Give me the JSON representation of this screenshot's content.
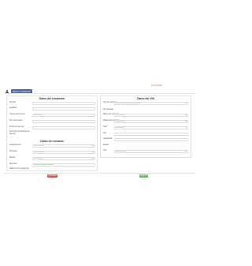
{
  "top_link": "Ir a la lista",
  "header": {
    "title": "Nuevo conductor"
  },
  "driver": {
    "title": "Datos del conductor",
    "fields": [
      {
        "label": "Nombre",
        "value": ""
      },
      {
        "label": "Apellidos",
        "value": ""
      },
      {
        "label": "Tipo de documento",
        "value": "Seleccione"
      },
      {
        "label": "Nro. documento",
        "value": ""
      },
      {
        "label": "Fecha de licencia",
        "value": ""
      },
      {
        "label": "Fecha de vencimiento de licencia",
        "value": ""
      }
    ]
  },
  "contact": {
    "title": "Datos de contacto",
    "fields": [
      {
        "label": "Departamento",
        "value": "Elija la opción"
      },
      {
        "label": "Provincia",
        "value": "Elija la opción"
      },
      {
        "label": "Distrito",
        "value": "Seleccione"
      },
      {
        "label": "Dirección",
        "value": "Ingrese dirección completa"
      },
      {
        "label": "Teléfono de emergencia",
        "value": ""
      }
    ]
  },
  "vehicle": {
    "title": "Datos del VIN",
    "fields": [
      {
        "label": "Tipo de vehículo",
        "value": "Elija la opción de tipo de vehículo"
      },
      {
        "label": "Nro de placa",
        "value": ""
      },
      {
        "label": "Marca del vehículo",
        "value": "Seleccione"
      },
      {
        "label": "Modelo del vehículo",
        "value": "Seleccione"
      },
      {
        "label": "Color",
        "value": "Seleccione"
      },
      {
        "label": "Año",
        "value": ""
      },
      {
        "label": "Capacidad",
        "value": ""
      },
      {
        "label": "Estado",
        "value": ""
      },
      {
        "label": "Tipo",
        "value": "Elija la opción"
      }
    ]
  },
  "buttons": {
    "cancel": "Cancelar",
    "save": "Guardar"
  }
}
